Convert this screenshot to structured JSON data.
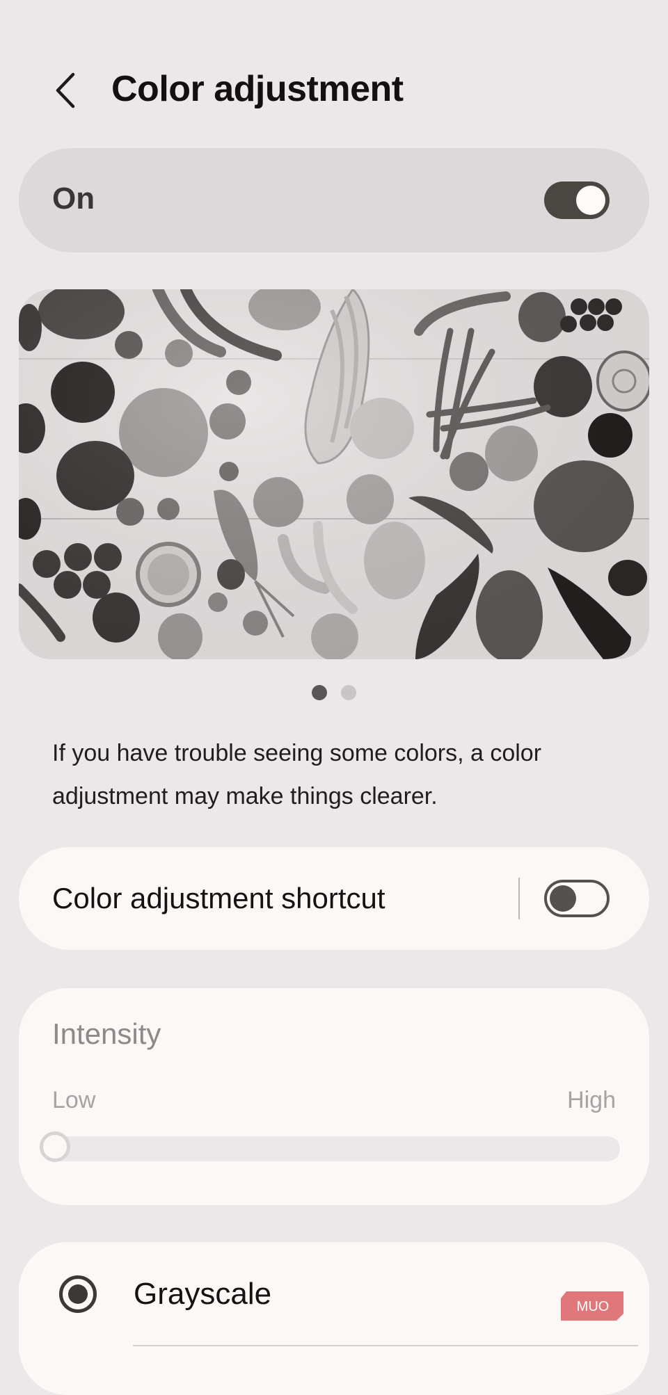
{
  "header": {
    "title": "Color adjustment",
    "back_icon": "chevron-left-icon"
  },
  "master": {
    "label": "On",
    "enabled": true
  },
  "preview": {
    "pages_total": 2,
    "active_page": 1
  },
  "description": "If you have trouble seeing some colors, a color adjustment may make things clearer.",
  "shortcut": {
    "label": "Color adjustment shortcut",
    "enabled": false
  },
  "intensity": {
    "title": "Intensity",
    "low_label": "Low",
    "high_label": "High",
    "value": 0
  },
  "options": [
    {
      "label": "Grayscale",
      "selected": true
    }
  ],
  "watermark": {
    "text": "MUO"
  },
  "colors": {
    "background": "#ece8e9",
    "card": "#fbf8f6",
    "master_card": "#ddd8da",
    "toggle_on": "#4a4641"
  }
}
